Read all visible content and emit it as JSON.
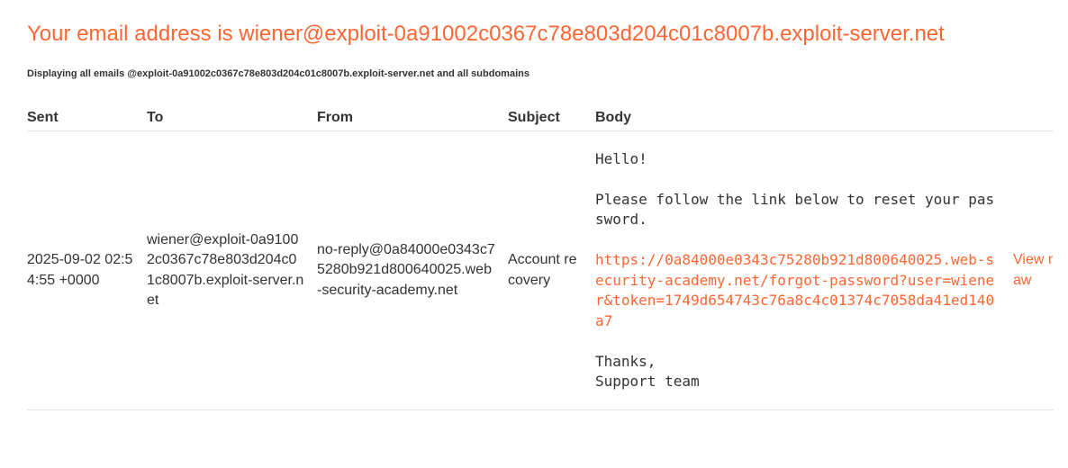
{
  "header": {
    "email_line": "Your email address is wiener@exploit-0a91002c0367c78e803d204c01c8007b.exploit-server.net",
    "display_note": "Displaying all emails @exploit-0a91002c0367c78e803d204c01c8007b.exploit-server.net and all subdomains"
  },
  "table": {
    "columns": [
      "Sent",
      "To",
      "From",
      "Subject",
      "Body"
    ],
    "rows": [
      {
        "sent": "2025-09-02 02:54:55 +0000",
        "to": "wiener@exploit-0a91002c0367c78e803d204c01c8007b.exploit-server.net",
        "from": "no-reply@0a84000e0343c75280b921d800640025.web-security-academy.net",
        "subject": "Account recovery",
        "body": {
          "greeting": "Hello!",
          "instruction": "Please follow the link below to reset your password.",
          "link": "https://0a84000e0343c75280b921d800640025.web-security-academy.net/forgot-password?user=wiener&token=1749d654743c76a8c4c01374c7058da41ed140a7",
          "signoff": "Thanks,",
          "signature": "Support team"
        },
        "view_raw_label": "View raw"
      }
    ]
  },
  "colors": {
    "accent": "#ff6633",
    "text": "#333333",
    "divider": "#e6e6e6",
    "background": "#ffffff"
  }
}
